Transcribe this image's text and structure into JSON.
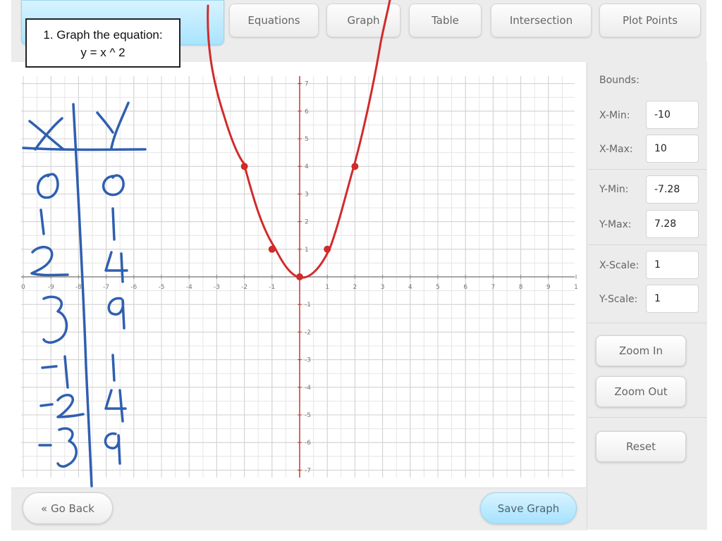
{
  "tabs": [
    {
      "label": "",
      "active": true
    },
    {
      "label": "Equations",
      "active": false
    },
    {
      "label": "Graph",
      "active": false
    },
    {
      "label": "Table",
      "active": false
    },
    {
      "label": "Intersection",
      "active": false
    },
    {
      "label": "Plot Points",
      "active": false
    }
  ],
  "question": {
    "line1": "1. Graph the equation:",
    "line2": "y = x ^ 2"
  },
  "bounds": {
    "title": "Bounds:",
    "xmin_label": "X-Min:",
    "xmin": "-10",
    "xmax_label": "X-Max:",
    "xmax": "10",
    "ymin_label": "Y-Min:",
    "ymin": "-7.28",
    "ymax_label": "Y-Max:",
    "ymax": "7.28",
    "xscale_label": "X-Scale:",
    "xscale": "1",
    "yscale_label": "Y-Scale:",
    "yscale": "1"
  },
  "buttons": {
    "zoom_in": "Zoom In",
    "zoom_out": "Zoom Out",
    "reset": "Reset",
    "go_back": "« Go Back",
    "save_graph": "Save Graph"
  },
  "graph": {
    "x_ticks": [
      "0",
      "-9",
      "-8",
      "-7",
      "-6",
      "-5",
      "-4",
      "-3",
      "-2",
      "-1",
      "1",
      "2",
      "3",
      "4",
      "5",
      "6",
      "7",
      "8",
      "9",
      "1"
    ],
    "y_ticks": [
      "7",
      "6",
      "5",
      "4",
      "3",
      "2",
      "1",
      "-1",
      "-2",
      "-3",
      "-4",
      "-5",
      "-6",
      "-7"
    ],
    "plotted_points": [
      [
        -2,
        4
      ],
      [
        -1,
        1
      ],
      [
        0,
        0
      ],
      [
        1,
        1
      ],
      [
        2,
        4
      ]
    ],
    "curve_color": "#d12b2b",
    "axis_color": "#c0392b"
  },
  "handwritten_table": {
    "header": [
      "X",
      "Y"
    ],
    "rows": [
      [
        "0",
        "0"
      ],
      [
        "1",
        "1"
      ],
      [
        "2",
        "4"
      ],
      [
        "3",
        "9"
      ],
      [
        "-1",
        "1"
      ],
      [
        "-2",
        "4"
      ],
      [
        "-3",
        "9"
      ]
    ],
    "ink_color": "#2f5fb0"
  }
}
